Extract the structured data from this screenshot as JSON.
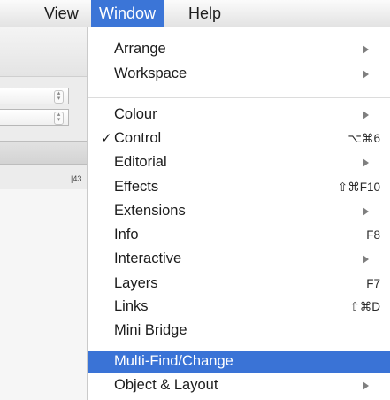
{
  "menubar": {
    "view": "View",
    "window": "Window",
    "help": "Help"
  },
  "background": {
    "ruler_mark": "|43"
  },
  "menu": {
    "group1": [
      {
        "label": "Arrange",
        "submenu": true
      },
      {
        "label": "Workspace",
        "submenu": true
      }
    ],
    "group2": [
      {
        "label": "Colour",
        "submenu": true
      },
      {
        "label": "Control",
        "checked": true,
        "shortcut": "⌥⌘6"
      },
      {
        "label": "Editorial",
        "submenu": true
      },
      {
        "label": "Effects",
        "shortcut": "⇧⌘F10"
      },
      {
        "label": "Extensions",
        "submenu": true
      },
      {
        "label": "Info",
        "shortcut": "F8"
      },
      {
        "label": "Interactive",
        "submenu": true
      },
      {
        "label": "Layers",
        "shortcut": "F7"
      },
      {
        "label": "Links",
        "shortcut": "⇧⌘D"
      },
      {
        "label": "Mini Bridge"
      },
      {
        "label": "Multi-Find/Change",
        "highlighted": true
      },
      {
        "label": "Object & Layout",
        "submenu": true
      }
    ],
    "check_glyph": "✓"
  },
  "colors": {
    "highlight": "#3a73d6",
    "menubar_active": "#3b75d7"
  }
}
